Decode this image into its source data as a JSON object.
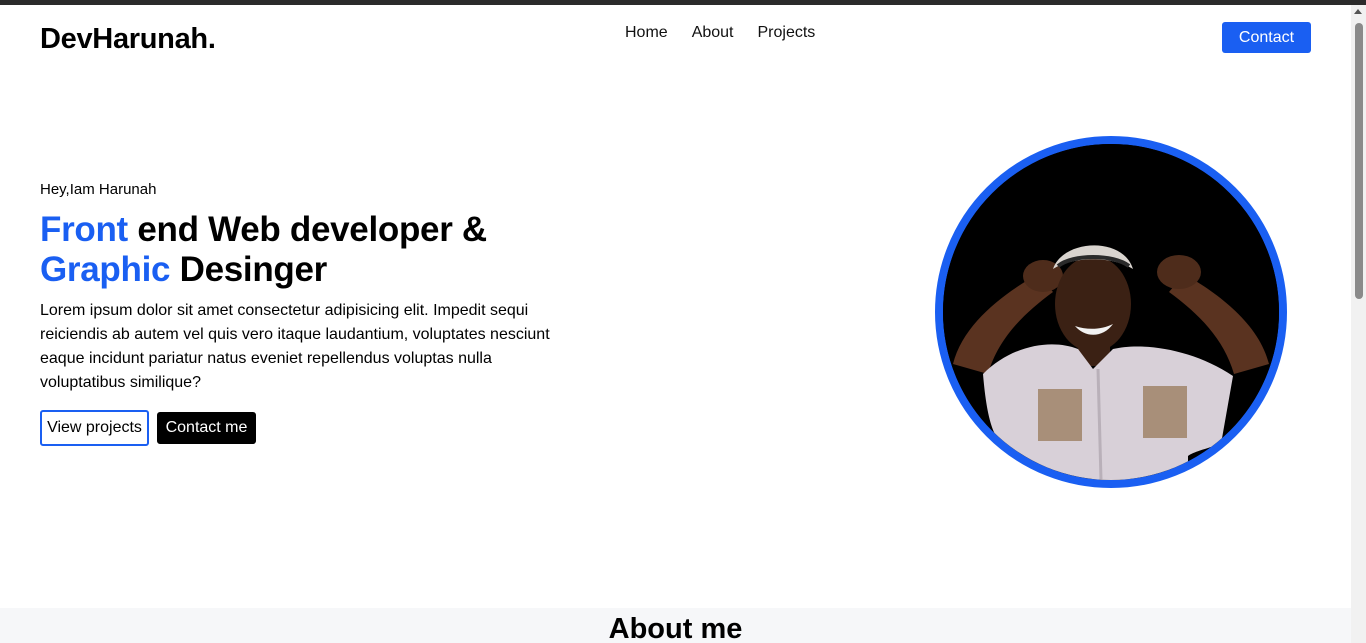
{
  "brand": {
    "logo": "DevHarunah."
  },
  "nav": {
    "items": [
      {
        "label": "Home"
      },
      {
        "label": "About"
      },
      {
        "label": "Projects"
      }
    ],
    "contact_label": "Contact"
  },
  "hero": {
    "greeting": "Hey,Iam Harunah",
    "headline": {
      "word1": "Front",
      "rest1": " end Web developer &",
      "word2": "Graphic",
      "rest2": " Desinger"
    },
    "intro": "Lorem ipsum dolor sit amet consectetur adipisicing elit. Impedit sequi reiciendis ab autem vel quis vero itaque laudantium, voluptates nesciunt eaque incidunt pariatur natus eveniet repellendus voluptas nulla voluptatibus similique?",
    "view_projects_label": "View projects",
    "contact_me_label": "Contact me",
    "portrait_icon": "profile-photo"
  },
  "about": {
    "title": "About me"
  },
  "colors": {
    "accent": "#1a5ff2",
    "text": "#000000",
    "background": "#ffffff",
    "section_bg": "#f6f7f9"
  }
}
